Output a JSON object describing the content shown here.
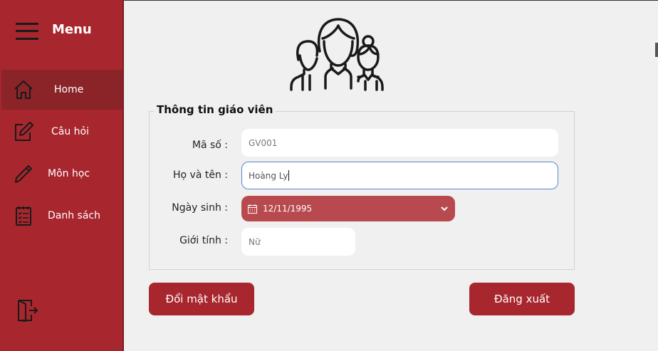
{
  "menu": {
    "title": "Menu"
  },
  "sidebar": {
    "items": [
      {
        "label": "Home",
        "icon": "home-icon",
        "active": true
      },
      {
        "label": "Câu hỏi",
        "icon": "edit-icon",
        "active": false
      },
      {
        "label": "Môn học",
        "icon": "pencil-icon",
        "active": false
      },
      {
        "label": "Danh sách",
        "icon": "checklist-icon",
        "active": false
      }
    ],
    "logout_icon": "exit-door-icon"
  },
  "form": {
    "title": "Thông tin giáo viên",
    "code_label": "Mã số :",
    "code_value": "GV001",
    "name_label": "Họ và tên :",
    "name_value": "Hoàng Ly",
    "birth_label": "Ngày sinh :",
    "birth_value": "12/11/1995",
    "gender_label": "Giới tính :",
    "gender_value": "Nữ"
  },
  "buttons": {
    "change_password": "Đổi mật khẩu",
    "logout": "Đăng xuất"
  },
  "colors": {
    "sidebar": "#a8262d",
    "sidebar_active": "#8b2429",
    "date_field": "#b84a4f",
    "background": "#f0f0f0"
  }
}
